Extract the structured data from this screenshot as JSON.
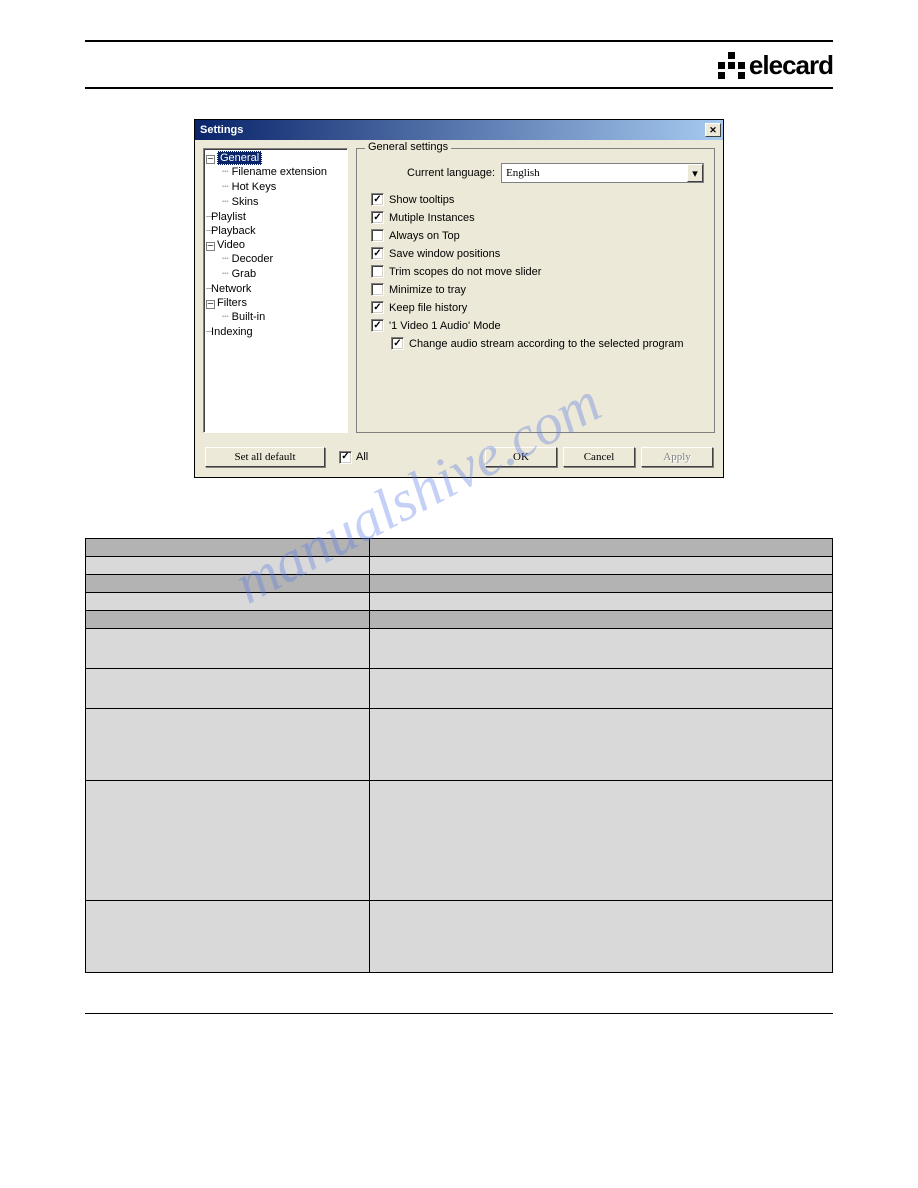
{
  "logo_text": "elecard",
  "dialog": {
    "title": "Settings",
    "tree": {
      "general": {
        "label": "General",
        "expanded": true,
        "children": [
          "Filename extension",
          "Hot Keys",
          "Skins"
        ]
      },
      "playlist": "Playlist",
      "playback": "Playback",
      "video": {
        "label": "Video",
        "expanded": true,
        "children": [
          "Decoder",
          "Grab"
        ]
      },
      "network": "Network",
      "filters": {
        "label": "Filters",
        "expanded": true,
        "children": [
          "Built-in"
        ]
      },
      "indexing": "Indexing"
    },
    "panel": {
      "legend": "General settings",
      "lang_label": "Current language:",
      "lang_value": "English",
      "options": [
        {
          "key": "tooltips",
          "label": "Show tooltips",
          "checked": true
        },
        {
          "key": "multi",
          "label": "Mutiple Instances",
          "checked": true
        },
        {
          "key": "ontop",
          "label": "Always on Top",
          "checked": false
        },
        {
          "key": "savepos",
          "label": "Save window positions",
          "checked": true
        },
        {
          "key": "trim",
          "label": "Trim scopes do not move slider",
          "checked": false
        },
        {
          "key": "tray",
          "label": "Minimize to tray",
          "checked": false
        },
        {
          "key": "history",
          "label": "Keep file history",
          "checked": true
        },
        {
          "key": "mode",
          "label": "'1 Video 1 Audio' Mode",
          "checked": true
        },
        {
          "key": "changeaudio",
          "label": "Change audio stream according to the selected program",
          "checked": true,
          "indent": true
        }
      ]
    },
    "footer": {
      "set_default": "Set all default",
      "all": "All",
      "all_checked": true,
      "ok": "OK",
      "cancel": "Cancel",
      "apply": "Apply"
    }
  },
  "watermark": "manualshive.com"
}
